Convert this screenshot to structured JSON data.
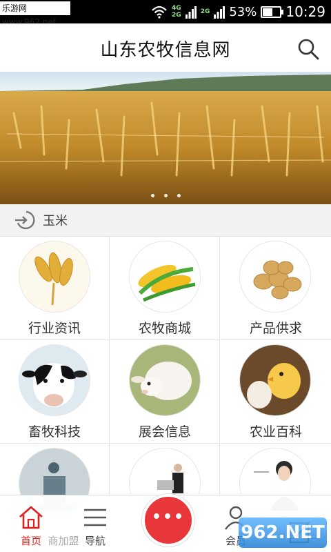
{
  "status": {
    "watermark": "乐游网 www.962.net",
    "net_top": "4G",
    "net_bottom": "2G",
    "net_extra": "2G",
    "battery": "53%",
    "time": "10:29"
  },
  "header": {
    "title": "山东农牧信息网"
  },
  "banner": {
    "slides": 3,
    "active_slide": 1
  },
  "notice": {
    "text": "玉米"
  },
  "grid": {
    "items": [
      {
        "label": "行业资讯",
        "icon": "wheat-icon"
      },
      {
        "label": "农牧商城",
        "icon": "corn-icon"
      },
      {
        "label": "产品供求",
        "icon": "potato-icon"
      },
      {
        "label": "畜牧科技",
        "icon": "cow-icon"
      },
      {
        "label": "展会信息",
        "icon": "sheep-icon"
      },
      {
        "label": "农业百科",
        "icon": "chick-icon"
      },
      {
        "label": "",
        "icon": "statue-icon"
      },
      {
        "label": "",
        "icon": "businessman-icon"
      },
      {
        "label": "",
        "icon": "customer-service-icon"
      }
    ]
  },
  "tabbar": {
    "items": [
      {
        "label": "首页",
        "active": true
      },
      {
        "label": "商加盟",
        "active": false
      },
      {
        "label": "导航",
        "active": false
      },
      {
        "label": "会员",
        "active": false
      },
      {
        "label": "",
        "active": false
      }
    ],
    "fab_glyph": "•••"
  },
  "overlay_watermark": "962.NET",
  "colors": {
    "accent": "#e8363a",
    "active_tab": "#e02020"
  }
}
